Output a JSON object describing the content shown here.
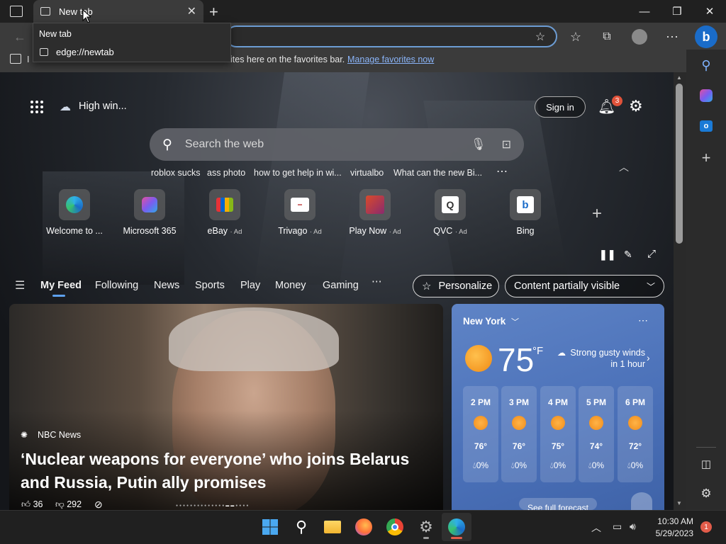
{
  "tab": {
    "title": "New tab"
  },
  "tooltip": {
    "title": "New tab",
    "url": "edge://newtab"
  },
  "favorites_bar": {
    "prefix": "I",
    "text": "ites here on the favorites bar.",
    "link": "Manage favorites now"
  },
  "weather_chip": "High win...",
  "header": {
    "sign_in": "Sign in",
    "notifications": "3"
  },
  "search": {
    "placeholder": "Search the web"
  },
  "suggestions": [
    "roblox sucks",
    "ass photo",
    "how to get help in wi...",
    "virtualbo",
    "What can the new Bi..."
  ],
  "quick_links": [
    {
      "label": "Welcome to ...",
      "ad": ""
    },
    {
      "label": "Microsoft 365",
      "ad": ""
    },
    {
      "label": "eBay",
      "ad": "· Ad"
    },
    {
      "label": "Trivago",
      "ad": "· Ad"
    },
    {
      "label": "Play Now",
      "ad": "· Ad"
    },
    {
      "label": "QVC",
      "ad": "· Ad"
    },
    {
      "label": "Bing",
      "ad": ""
    }
  ],
  "feed_nav": [
    "My Feed",
    "Following",
    "News",
    "Sports",
    "Play",
    "Money",
    "Gaming"
  ],
  "buttons": {
    "personalize": "Personalize",
    "content": "Content partially visible"
  },
  "hero": {
    "source": "NBC News",
    "headline": "‘Nuclear weapons for everyone’ who joins Belarus and Russia, Putin ally promises",
    "likes": "36",
    "dislikes": "292"
  },
  "weather": {
    "city": "New York",
    "temp": "75",
    "unit": "°F",
    "alert": "Strong gusty winds in 1 hour",
    "hours": [
      {
        "time": "2 PM",
        "temp": "76°",
        "precip": "0%"
      },
      {
        "time": "3 PM",
        "temp": "76°",
        "precip": "0%"
      },
      {
        "time": "4 PM",
        "temp": "75°",
        "precip": "0%"
      },
      {
        "time": "5 PM",
        "temp": "74°",
        "precip": "0%"
      },
      {
        "time": "6 PM",
        "temp": "72°",
        "precip": "0%"
      }
    ],
    "see_full": "See full forecast"
  },
  "clock": {
    "time": "10:30 AM",
    "date": "5/29/2023",
    "badge": "1"
  }
}
